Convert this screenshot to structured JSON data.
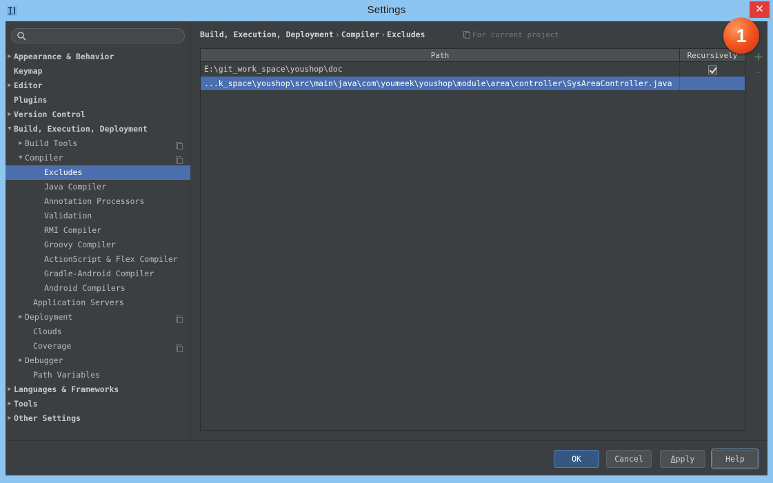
{
  "window": {
    "title": "Settings",
    "app_icon": "intellij-idea-icon",
    "close_label": "✕"
  },
  "sidebar": {
    "search": {
      "value": "",
      "placeholder": "",
      "icon": "search-icon"
    },
    "items": [
      {
        "label": "Appearance & Behavior",
        "indent": 12,
        "arrow": "▶",
        "bold": true,
        "selected": false,
        "scope_icon": false
      },
      {
        "label": "Keymap",
        "indent": 12,
        "arrow": "",
        "bold": true,
        "selected": false,
        "scope_icon": false
      },
      {
        "label": "Editor",
        "indent": 12,
        "arrow": "▶",
        "bold": true,
        "selected": false,
        "scope_icon": false
      },
      {
        "label": "Plugins",
        "indent": 12,
        "arrow": "",
        "bold": true,
        "selected": false,
        "scope_icon": false
      },
      {
        "label": "Version Control",
        "indent": 12,
        "arrow": "▶",
        "bold": true,
        "selected": false,
        "scope_icon": false
      },
      {
        "label": "Build, Execution, Deployment",
        "indent": 12,
        "arrow": "▼",
        "bold": true,
        "selected": false,
        "scope_icon": false
      },
      {
        "label": "Build Tools",
        "indent": 28,
        "arrow": "▶",
        "bold": false,
        "selected": false,
        "scope_icon": true
      },
      {
        "label": "Compiler",
        "indent": 28,
        "arrow": "▼",
        "bold": false,
        "selected": false,
        "scope_icon": true
      },
      {
        "label": "Excludes",
        "indent": 56,
        "arrow": "",
        "bold": false,
        "selected": true,
        "scope_icon": false
      },
      {
        "label": "Java Compiler",
        "indent": 56,
        "arrow": "",
        "bold": false,
        "selected": false,
        "scope_icon": false
      },
      {
        "label": "Annotation Processors",
        "indent": 56,
        "arrow": "",
        "bold": false,
        "selected": false,
        "scope_icon": false
      },
      {
        "label": "Validation",
        "indent": 56,
        "arrow": "",
        "bold": false,
        "selected": false,
        "scope_icon": false
      },
      {
        "label": "RMI Compiler",
        "indent": 56,
        "arrow": "",
        "bold": false,
        "selected": false,
        "scope_icon": false
      },
      {
        "label": "Groovy Compiler",
        "indent": 56,
        "arrow": "",
        "bold": false,
        "selected": false,
        "scope_icon": false
      },
      {
        "label": "ActionScript & Flex Compiler",
        "indent": 56,
        "arrow": "",
        "bold": false,
        "selected": false,
        "scope_icon": false
      },
      {
        "label": "Gradle-Android Compiler",
        "indent": 56,
        "arrow": "",
        "bold": false,
        "selected": false,
        "scope_icon": false
      },
      {
        "label": "Android Compilers",
        "indent": 56,
        "arrow": "",
        "bold": false,
        "selected": false,
        "scope_icon": false
      },
      {
        "label": "Application Servers",
        "indent": 40,
        "arrow": "",
        "bold": false,
        "selected": false,
        "scope_icon": false
      },
      {
        "label": "Deployment",
        "indent": 28,
        "arrow": "▶",
        "bold": false,
        "selected": false,
        "scope_icon": true
      },
      {
        "label": "Clouds",
        "indent": 40,
        "arrow": "",
        "bold": false,
        "selected": false,
        "scope_icon": false
      },
      {
        "label": "Coverage",
        "indent": 40,
        "arrow": "",
        "bold": false,
        "selected": false,
        "scope_icon": true
      },
      {
        "label": "Debugger",
        "indent": 28,
        "arrow": "▶",
        "bold": false,
        "selected": false,
        "scope_icon": false
      },
      {
        "label": "Path Variables",
        "indent": 40,
        "arrow": "",
        "bold": false,
        "selected": false,
        "scope_icon": false
      },
      {
        "label": "Languages & Frameworks",
        "indent": 12,
        "arrow": "▶",
        "bold": true,
        "selected": false,
        "scope_icon": false
      },
      {
        "label": "Tools",
        "indent": 12,
        "arrow": "▶",
        "bold": true,
        "selected": false,
        "scope_icon": false
      },
      {
        "label": "Other Settings",
        "indent": 12,
        "arrow": "▶",
        "bold": true,
        "selected": false,
        "scope_icon": false
      }
    ]
  },
  "main": {
    "breadcrumb": {
      "part1": "Build, Execution, Deployment",
      "sep1": "›",
      "part2": "Compiler",
      "sep2": "›",
      "part3": "Excludes"
    },
    "scope_note": {
      "text": "For current project",
      "icon": "project-scope-icon"
    },
    "table": {
      "columns": [
        "Path",
        "Recursively"
      ],
      "rows": [
        {
          "path": "E:\\git_work_space\\youshop\\doc",
          "recursively": true,
          "selected": false
        },
        {
          "path": "...k_space\\youshop\\src\\main\\java\\com\\youmeek\\youshop\\module\\area\\controller\\SysAreaController.java",
          "recursively": false,
          "selected": true
        }
      ]
    },
    "tools": {
      "add_label": "+",
      "remove_label": "–",
      "add_icon": "plus-icon",
      "remove_icon": "minus-icon"
    }
  },
  "annotations": {
    "badge_1": "1"
  },
  "buttons": {
    "ok": "OK",
    "cancel": "Cancel",
    "apply_pre": "A",
    "apply_post": "pply",
    "help": "Help"
  },
  "colors": {
    "chrome": "#8ec5f0",
    "panel": "#3c3f41",
    "selection": "#4b6eaf",
    "accent_green": "#4e9a4e",
    "close_red": "#e23b3b",
    "badge_orange": "#f4551f",
    "default_button_blue": "#365880"
  }
}
